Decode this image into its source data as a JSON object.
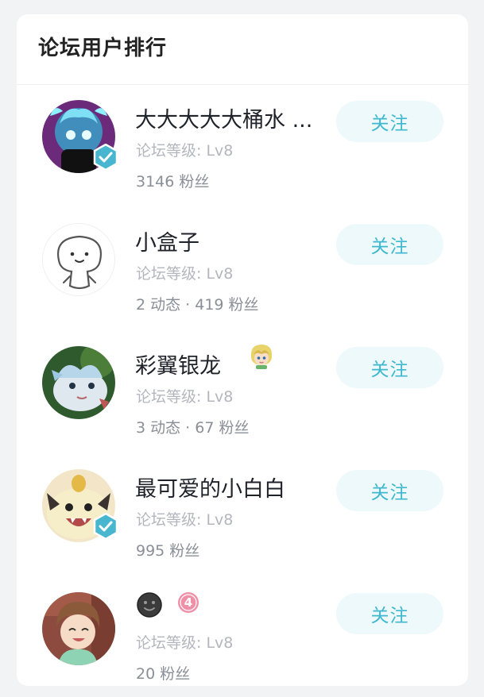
{
  "panel": {
    "title": "论坛用户排行"
  },
  "users": [
    {
      "name": "大大大大大桶水 ...",
      "level": "论坛等级: Lv8",
      "stats": "3146 粉丝",
      "follow": "关注"
    },
    {
      "name": "小盒子",
      "level": "论坛等级: Lv8",
      "stats": "2 动态 · 419 粉丝",
      "follow": "关注"
    },
    {
      "name": "彩翼银龙",
      "level": "论坛等级: Lv8",
      "stats": "3 动态 · 67 粉丝",
      "follow": "关注"
    },
    {
      "name": "最可爱的小白白",
      "level": "论坛等级: Lv8",
      "stats": "995 粉丝",
      "follow": "关注"
    },
    {
      "name": "",
      "badge_number": "4",
      "level": "论坛等级: Lv8",
      "stats": "20 粉丝",
      "follow": "关注"
    }
  ],
  "colors": {
    "accent": "#3fb8cf",
    "follow_bg": "#eef9fb",
    "verified": "#49b6cf"
  }
}
